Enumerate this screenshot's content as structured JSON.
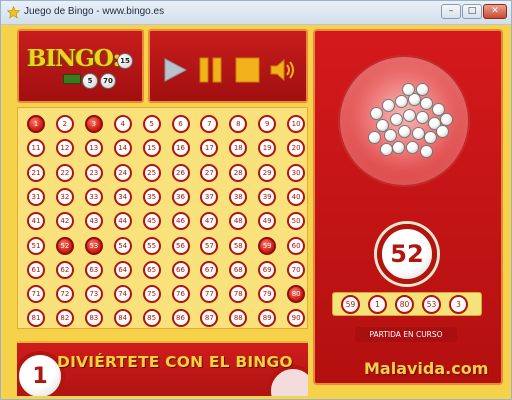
{
  "window": {
    "title": "Juego de Bingo - www.bingo.es",
    "minimize_label": "–",
    "maximize_label": "□",
    "close_label": "✕"
  },
  "logo": {
    "text": "BINGO:",
    "small_balls": [
      "15",
      "5",
      "70"
    ]
  },
  "controls": {
    "play": "play-icon",
    "pause": "pause-icon",
    "stop": "stop-icon",
    "sound": "speaker-icon"
  },
  "board": {
    "numbers": [
      "1",
      "2",
      "3",
      "4",
      "5",
      "6",
      "7",
      "8",
      "9",
      "10",
      "11",
      "12",
      "13",
      "14",
      "15",
      "16",
      "17",
      "18",
      "19",
      "20",
      "21",
      "22",
      "23",
      "24",
      "25",
      "26",
      "27",
      "28",
      "29",
      "30",
      "31",
      "32",
      "33",
      "34",
      "35",
      "36",
      "37",
      "38",
      "39",
      "40",
      "41",
      "42",
      "43",
      "44",
      "45",
      "46",
      "47",
      "48",
      "49",
      "50",
      "51",
      "52",
      "53",
      "54",
      "55",
      "56",
      "57",
      "58",
      "59",
      "60",
      "61",
      "62",
      "63",
      "64",
      "65",
      "66",
      "67",
      "68",
      "69",
      "70",
      "71",
      "72",
      "73",
      "74",
      "75",
      "76",
      "77",
      "78",
      "79",
      "80",
      "81",
      "82",
      "83",
      "84",
      "85",
      "86",
      "87",
      "88",
      "89",
      "90"
    ],
    "marked": [
      "1",
      "3",
      "52",
      "53",
      "59",
      "80"
    ]
  },
  "banner": {
    "ball_number": "1",
    "text": "DIVIÉRTETE CON EL BINGO"
  },
  "draw": {
    "current_number": "52",
    "recent_numbers": [
      "59",
      "1",
      "80",
      "53",
      "3"
    ],
    "status": "PARTIDA EN CURSO"
  },
  "watermark": "Malavida.com",
  "colors": {
    "background": "#f6d24a",
    "panel_red": "#c81d1d",
    "ball_border": "#b0150f",
    "marked_ball": "#d42116"
  }
}
